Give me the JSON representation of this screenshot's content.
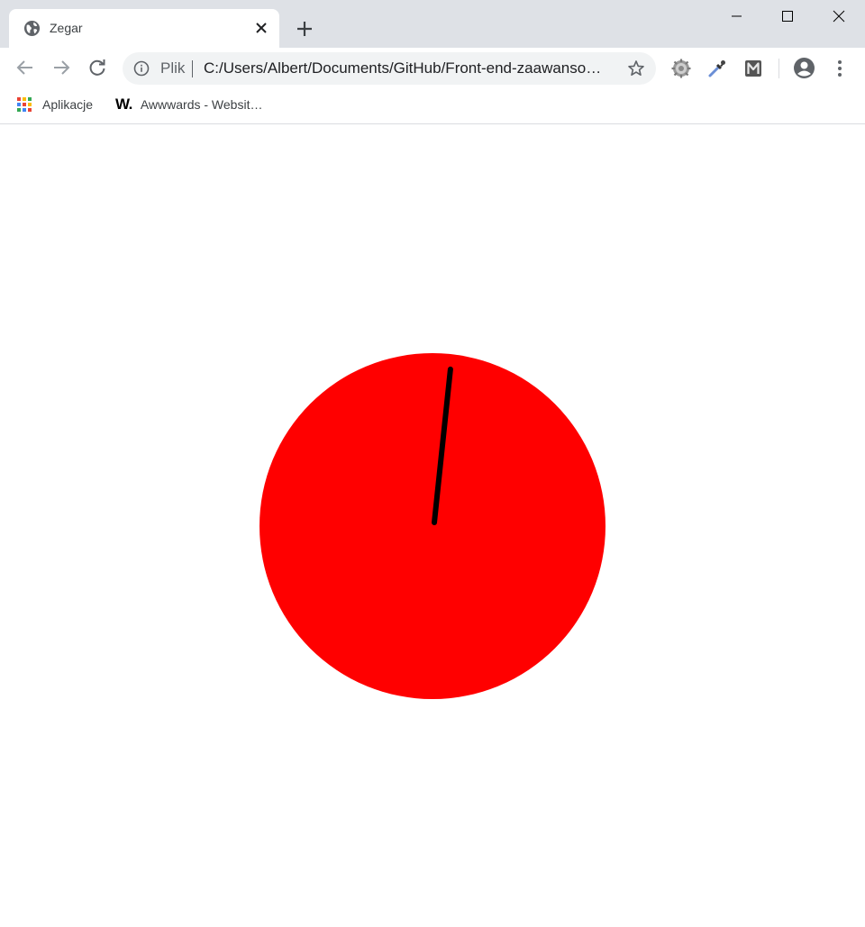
{
  "window": {
    "tab_title": "Zegar"
  },
  "toolbar": {
    "scheme_chip": "Plik",
    "url": "C:/Users/Albert/Documents/GitHub/Front-end-zaawanso…"
  },
  "bookmarks": {
    "items": [
      {
        "label": "Aplikacje",
        "icon": "apps-grid-icon"
      },
      {
        "label": "Awwwards - Websit…",
        "icon": "awwwards-logo"
      }
    ],
    "awwwards_logo_text": "W."
  },
  "clock": {
    "face_color": "#ff0000",
    "hand_color": "#000000",
    "seconds_shown": 1
  },
  "colors": {
    "titlebar": "#dee1e6",
    "toolbar": "#ffffff",
    "omnibox": "#f1f3f4",
    "icon": "#5f6368"
  }
}
